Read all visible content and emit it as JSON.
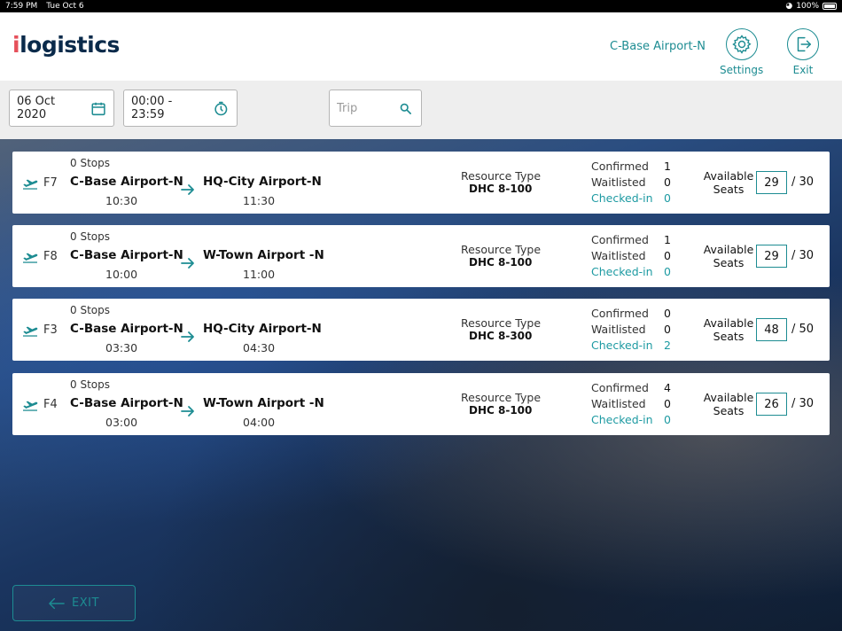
{
  "status_bar": {
    "time": "7:59 PM",
    "date": "Tue Oct 6",
    "battery": "100%"
  },
  "header": {
    "logo_i": "i",
    "logo_rest": "logistics",
    "station": "C-Base Airport-N",
    "settings_label": "Settings",
    "exit_label": "Exit"
  },
  "filters": {
    "date": "06 Oct 2020",
    "time_range": "00:00 - 23:59",
    "trip_placeholder": "Trip"
  },
  "labels": {
    "resource_type": "Resource Type",
    "confirmed": "Confirmed",
    "waitlisted": "Waitlisted",
    "checked_in": "Checked-in",
    "available_seats": "Available Seats"
  },
  "trips": [
    {
      "flight": "F7",
      "stops": "0 Stops",
      "origin": "C-Base Airport-N",
      "dep_time": "10:30",
      "dest": "HQ-City Airport-N",
      "arr_time": "11:30",
      "resource": "DHC 8-100",
      "confirmed": "1",
      "waitlisted": "0",
      "checked_in": "0",
      "available": "29",
      "capacity": "/ 30"
    },
    {
      "flight": "F8",
      "stops": "0 Stops",
      "origin": "C-Base Airport-N",
      "dep_time": "10:00",
      "dest": "W-Town Airport -N",
      "arr_time": "11:00",
      "resource": "DHC 8-100",
      "confirmed": "1",
      "waitlisted": "0",
      "checked_in": "0",
      "available": "29",
      "capacity": "/ 30"
    },
    {
      "flight": "F3",
      "stops": "0 Stops",
      "origin": "C-Base Airport-N",
      "dep_time": "03:30",
      "dest": "HQ-City Airport-N",
      "arr_time": "04:30",
      "resource": "DHC 8-300",
      "confirmed": "0",
      "waitlisted": "0",
      "checked_in": "2",
      "available": "48",
      "capacity": "/ 50"
    },
    {
      "flight": "F4",
      "stops": "0 Stops",
      "origin": "C-Base Airport-N",
      "dep_time": "03:00",
      "dest": "W-Town Airport -N",
      "arr_time": "04:00",
      "resource": "DHC 8-100",
      "confirmed": "4",
      "waitlisted": "0",
      "checked_in": "0",
      "available": "26",
      "capacity": "/ 30"
    }
  ],
  "bottom": {
    "exit_label": "EXIT"
  },
  "colors": {
    "accent": "#1d8c92",
    "logo_dark": "#0a2a4a",
    "logo_red": "#e5505a"
  },
  "icons": [
    "calendar-icon",
    "timer-icon",
    "search-icon",
    "gear-icon",
    "logout-icon",
    "plane-takeoff-icon",
    "arrow-right-icon",
    "arrow-left-icon"
  ]
}
